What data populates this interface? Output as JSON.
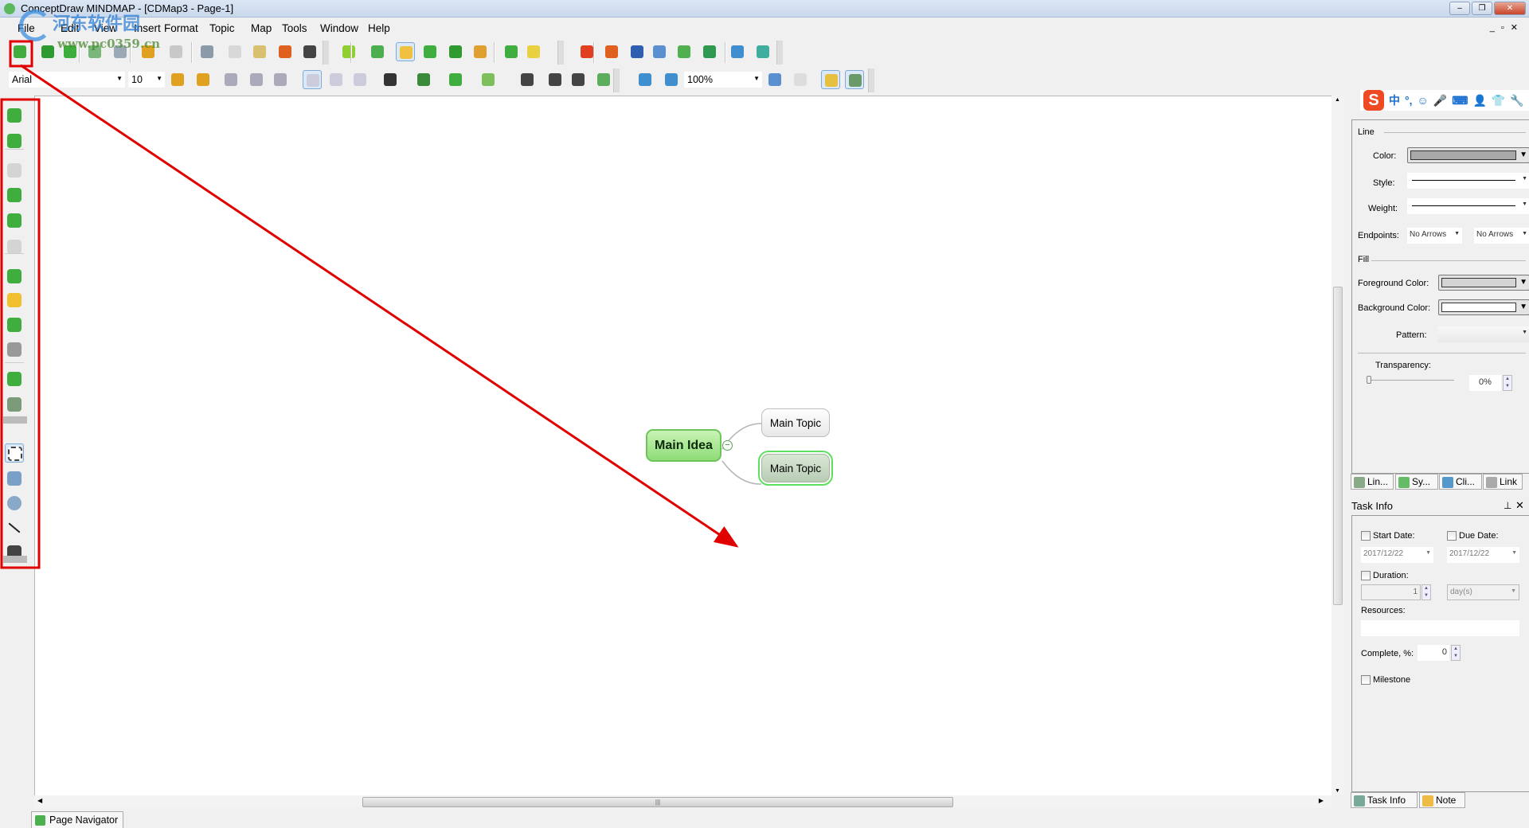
{
  "window": {
    "title": "ConceptDraw MINDMAP - [CDMap3 - Page-1]",
    "controls": [
      "minimize",
      "restore",
      "close"
    ],
    "mdi_controls": [
      "_",
      "▫",
      "✕"
    ]
  },
  "watermark": {
    "site_name": "河东软件园",
    "url": "www.pc0359.cn"
  },
  "menu": [
    "File",
    "Edit",
    "View",
    "Insert",
    "Format",
    "Topic",
    "Map",
    "Tools",
    "Window",
    "Help"
  ],
  "toolbar1": {
    "icons": [
      {
        "name": "new-icon",
        "color": "#3fae3f"
      },
      {
        "name": "open-icon",
        "color": "#2f9a2f"
      },
      {
        "name": "save-icon",
        "color": "#3cae3c"
      },
      {
        "name": "print-icon",
        "color": "#7ab77a"
      },
      {
        "name": "print-preview-icon",
        "color": "#9aa9b5"
      },
      {
        "name": "undo-icon",
        "color": "#e0a020"
      },
      {
        "name": "redo-icon",
        "color": "#c8c8c8"
      },
      {
        "name": "cut-icon",
        "color": "#8a9aa8"
      },
      {
        "name": "copy-icon",
        "color": "#d8d8d8"
      },
      {
        "name": "paste-icon",
        "color": "#d8c070"
      },
      {
        "name": "delete-icon",
        "color": "#e06020"
      },
      {
        "name": "find-icon",
        "color": "#444"
      },
      {
        "name": "brainstorm-icon",
        "color": "#8fcf30"
      },
      {
        "name": "left-layout-icon",
        "color": "#4cae4c"
      },
      {
        "name": "radial-layout-icon",
        "color": "#f0c040"
      },
      {
        "name": "organic-layout-icon",
        "color": "#3fae3f"
      },
      {
        "name": "cycle-layout-icon",
        "color": "#2f9a2f"
      },
      {
        "name": "tree-layout-icon",
        "color": "#e0a030"
      },
      {
        "name": "numbering-icon",
        "color": "#3fae3f"
      },
      {
        "name": "insert-picture-icon",
        "color": "#e8d040"
      },
      {
        "name": "export-pdf-icon",
        "color": "#e04020"
      },
      {
        "name": "export-ppt-icon",
        "color": "#e06020"
      },
      {
        "name": "export-word-icon",
        "color": "#2f5fb0"
      },
      {
        "name": "export-project-icon",
        "color": "#5a8fd0"
      },
      {
        "name": "export-image-icon",
        "color": "#50b050"
      },
      {
        "name": "export-excel-icon",
        "color": "#2f9a4f"
      },
      {
        "name": "gantt-icon",
        "color": "#3f8fd0"
      },
      {
        "name": "outline-icon",
        "color": "#3fae9f"
      }
    ]
  },
  "font": {
    "family": "Arial",
    "size": "10"
  },
  "zoom": "100%",
  "toolbar2": {
    "icons": [
      {
        "name": "grow-font-icon",
        "color": "#e0a020"
      },
      {
        "name": "shrink-font-icon",
        "color": "#e0a020"
      },
      {
        "name": "bold-icon",
        "color": "#aab"
      },
      {
        "name": "italic-icon",
        "color": "#aab"
      },
      {
        "name": "underline-icon",
        "color": "#aab"
      },
      {
        "name": "align-left-icon",
        "color": "#ccd"
      },
      {
        "name": "align-center-icon",
        "color": "#ccd"
      },
      {
        "name": "align-right-icon",
        "color": "#ccd"
      },
      {
        "name": "font-color-icon",
        "color": "#333"
      },
      {
        "name": "highlight-icon",
        "color": "#3a8a3a"
      },
      {
        "name": "line-color-icon",
        "color": "#3fae3f"
      },
      {
        "name": "fill-color-icon",
        "color": "#7cbf5c"
      },
      {
        "name": "text-format-icon",
        "color": "#444"
      },
      {
        "name": "paragraph-icon",
        "color": "#444"
      },
      {
        "name": "indent-icon",
        "color": "#444"
      },
      {
        "name": "format-painter-icon",
        "color": "#5cae5c"
      },
      {
        "name": "zoom-in-icon",
        "color": "#3f8fd0"
      },
      {
        "name": "zoom-out-icon",
        "color": "#3f8fd0"
      },
      {
        "name": "zoom-selection-icon",
        "color": "#5a8fd0"
      },
      {
        "name": "pan-hand-icon",
        "color": "#ddd"
      },
      {
        "name": "edit-mode-icon",
        "color": "#e8c040"
      },
      {
        "name": "presentation-mode-icon",
        "color": "#6a9a6a"
      }
    ]
  },
  "left_toolbar": [
    {
      "name": "add-topic-icon",
      "color": "#3fae3f"
    },
    {
      "name": "add-subtopic-icon",
      "color": "#3fae3f"
    },
    {
      "name": "add-callout-disabled-icon",
      "color": "#d4d4d4"
    },
    {
      "name": "add-floating-topic-icon",
      "color": "#3fae3f"
    },
    {
      "name": "move-up-icon",
      "color": "#3fae3f"
    },
    {
      "name": "move-down-disabled-icon",
      "color": "#d4d4d4"
    },
    {
      "name": "add-note-topic-icon",
      "color": "#3fae3f"
    },
    {
      "name": "add-comment-icon",
      "color": "#f0c030"
    },
    {
      "name": "add-boundary-icon",
      "color": "#3fae3f"
    },
    {
      "name": "add-relationship-icon",
      "color": "#999"
    },
    {
      "name": "add-hyperlink-icon",
      "color": "#3fae3f"
    },
    {
      "name": "add-picture-icon",
      "color": "#7a9a7a"
    },
    {
      "name": "select-tool-icon",
      "color": "#fff"
    },
    {
      "name": "rectangle-tool-icon",
      "color": "#7aa0c8"
    },
    {
      "name": "ellipse-tool-icon",
      "color": "#8aa8c8"
    },
    {
      "name": "line-tool-icon",
      "color": "#222"
    },
    {
      "name": "curve-tool-icon",
      "color": "#444"
    }
  ],
  "map": {
    "main_idea": "Main Idea",
    "topics": [
      "Main Topic",
      "Main Topic"
    ]
  },
  "format_panel": {
    "partial_title": "Li",
    "line_section": "Line",
    "color_label": "Color:",
    "line_color": "#a8a8a8",
    "style_label": "Style:",
    "weight_label": "Weight:",
    "endpoints_label": "Endpoints:",
    "endpoint_start": "No Arrows",
    "endpoint_end": "No Arrows",
    "fill_section": "Fill",
    "foreground_label": "Foreground Color:",
    "foreground_color": "#d4d4d4",
    "background_label": "Background Color:",
    "background_color": "#ffffff",
    "pattern_label": "Pattern:",
    "transparency_label": "Transparency:",
    "transparency": "0%",
    "tabs": [
      "Lin...",
      "Sy...",
      "Cli...",
      "Link"
    ]
  },
  "task_info": {
    "title": "Task Info",
    "start_label": "Start Date:",
    "start_date": "2017/12/22",
    "due_label": "Due Date:",
    "due_date": "2017/12/22",
    "duration_label": "Duration:",
    "duration": "1",
    "duration_unit": "day(s)",
    "resources_label": "Resources:",
    "resources": "",
    "complete_label": "Complete, %:",
    "complete": "0",
    "milestone_label": "Milestone",
    "tabs": [
      "Task Info",
      "Note"
    ]
  },
  "ime": {
    "icons": [
      "中",
      "°,",
      "☺",
      "🎤",
      "⌨",
      "👤",
      "👕",
      "🔧"
    ]
  },
  "bottom": {
    "page_navigator": "Page Navigator"
  }
}
